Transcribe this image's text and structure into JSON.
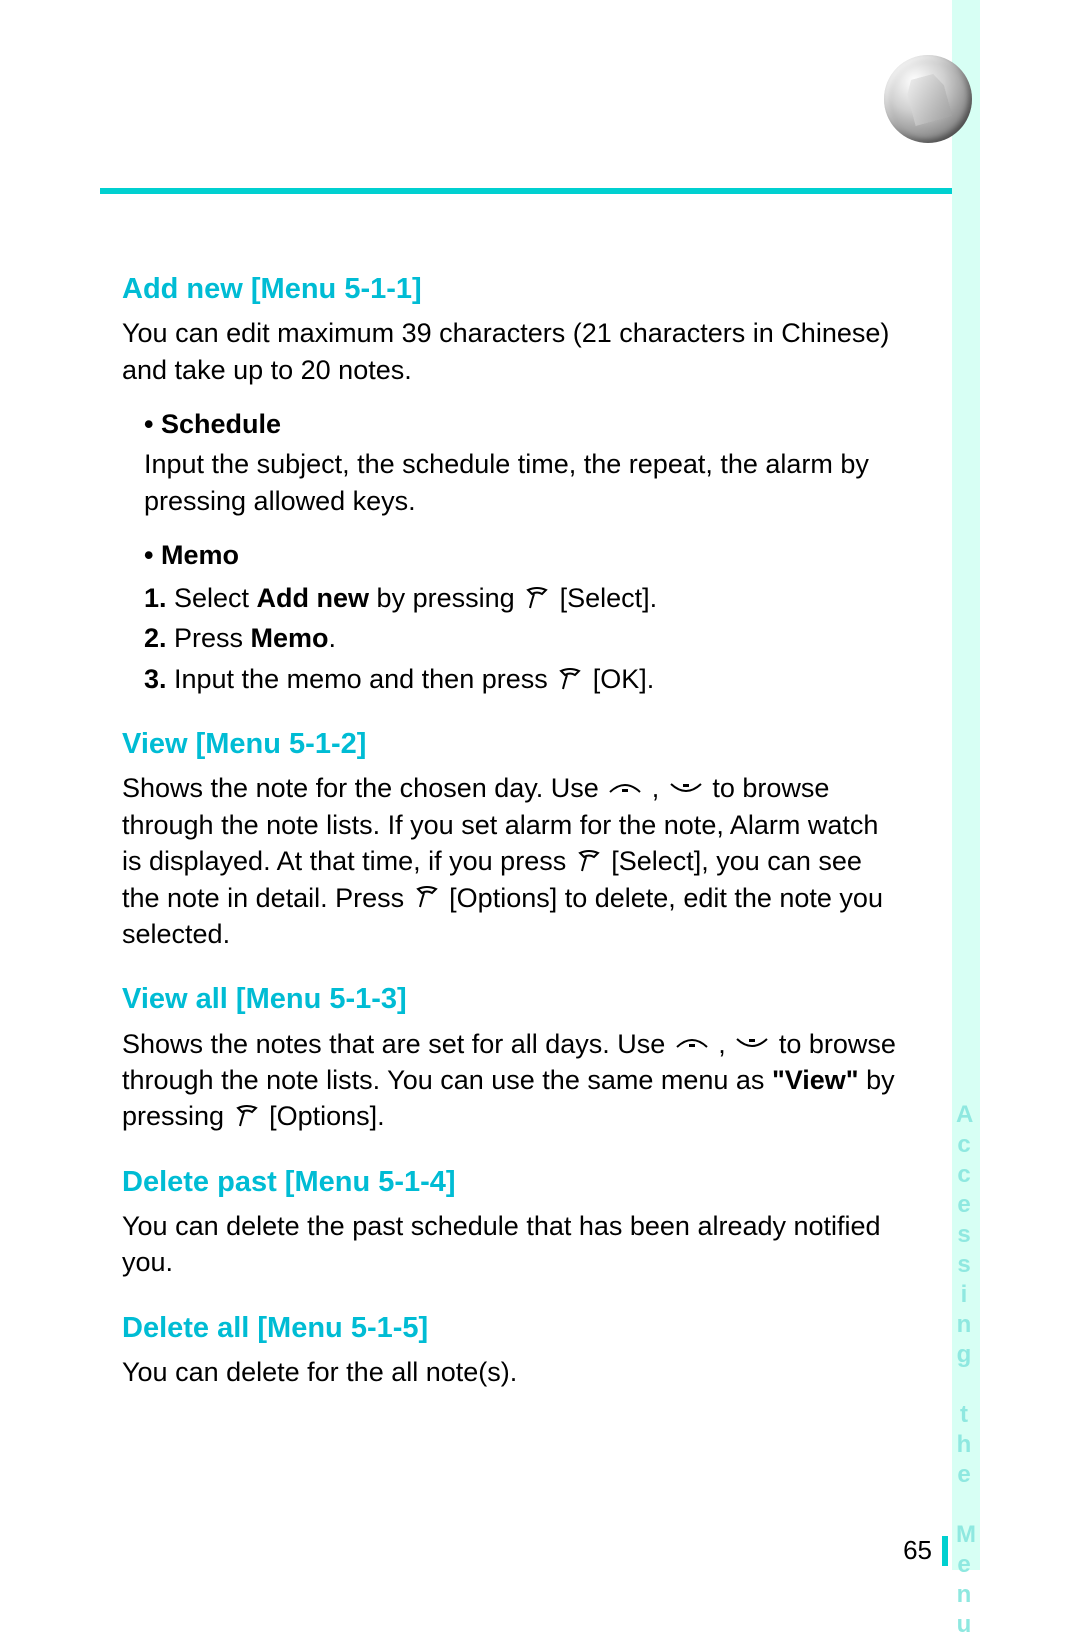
{
  "page": {
    "number": "65",
    "side_label": "Accessing the Menu"
  },
  "sections": {
    "add_new": {
      "title": "Add new [Menu 5-1-1]",
      "intro": "You can edit maximum 39 characters (21 characters in Chinese) and take up to 20 notes.",
      "schedule": {
        "head": "• Schedule",
        "body": "Input the subject, the schedule time, the repeat, the alarm by pressing allowed keys."
      },
      "memo": {
        "head": "• Memo",
        "step1_a": "Select ",
        "step1_b": "Add new",
        "step1_c": " by pressing ",
        "step1_d": " [Select].",
        "step2_a": "Press ",
        "step2_b": "Memo",
        "step2_c": ".",
        "step3_a": "Input the memo and then press ",
        "step3_b": " [OK]."
      }
    },
    "view": {
      "title": "View [Menu 5-1-2]",
      "p_a": "Shows the note for the chosen day. Use ",
      "p_b": " , ",
      "p_c": " to browse through the note lists. If you set alarm for the note, Alarm watch is displayed. At that time, if you press ",
      "p_d": " [Select], you can see the note in detail. Press ",
      "p_e": " [Options] to delete, edit the note you selected."
    },
    "view_all": {
      "title": "View all [Menu 5-1-3]",
      "p_a": "Shows the notes that are set for all days. Use ",
      "p_b": " , ",
      "p_c": " to browse through the note lists. You can use the same menu as ",
      "p_d": "\"View\"",
      "p_e": " by pressing ",
      "p_f": " [Options]."
    },
    "delete_past": {
      "title": "Delete past [Menu 5-1-4]",
      "body": "You can delete the past schedule that has been already notified you."
    },
    "delete_all": {
      "title": "Delete all [Menu 5-1-5]",
      "body": "You can delete for the all note(s)."
    }
  }
}
